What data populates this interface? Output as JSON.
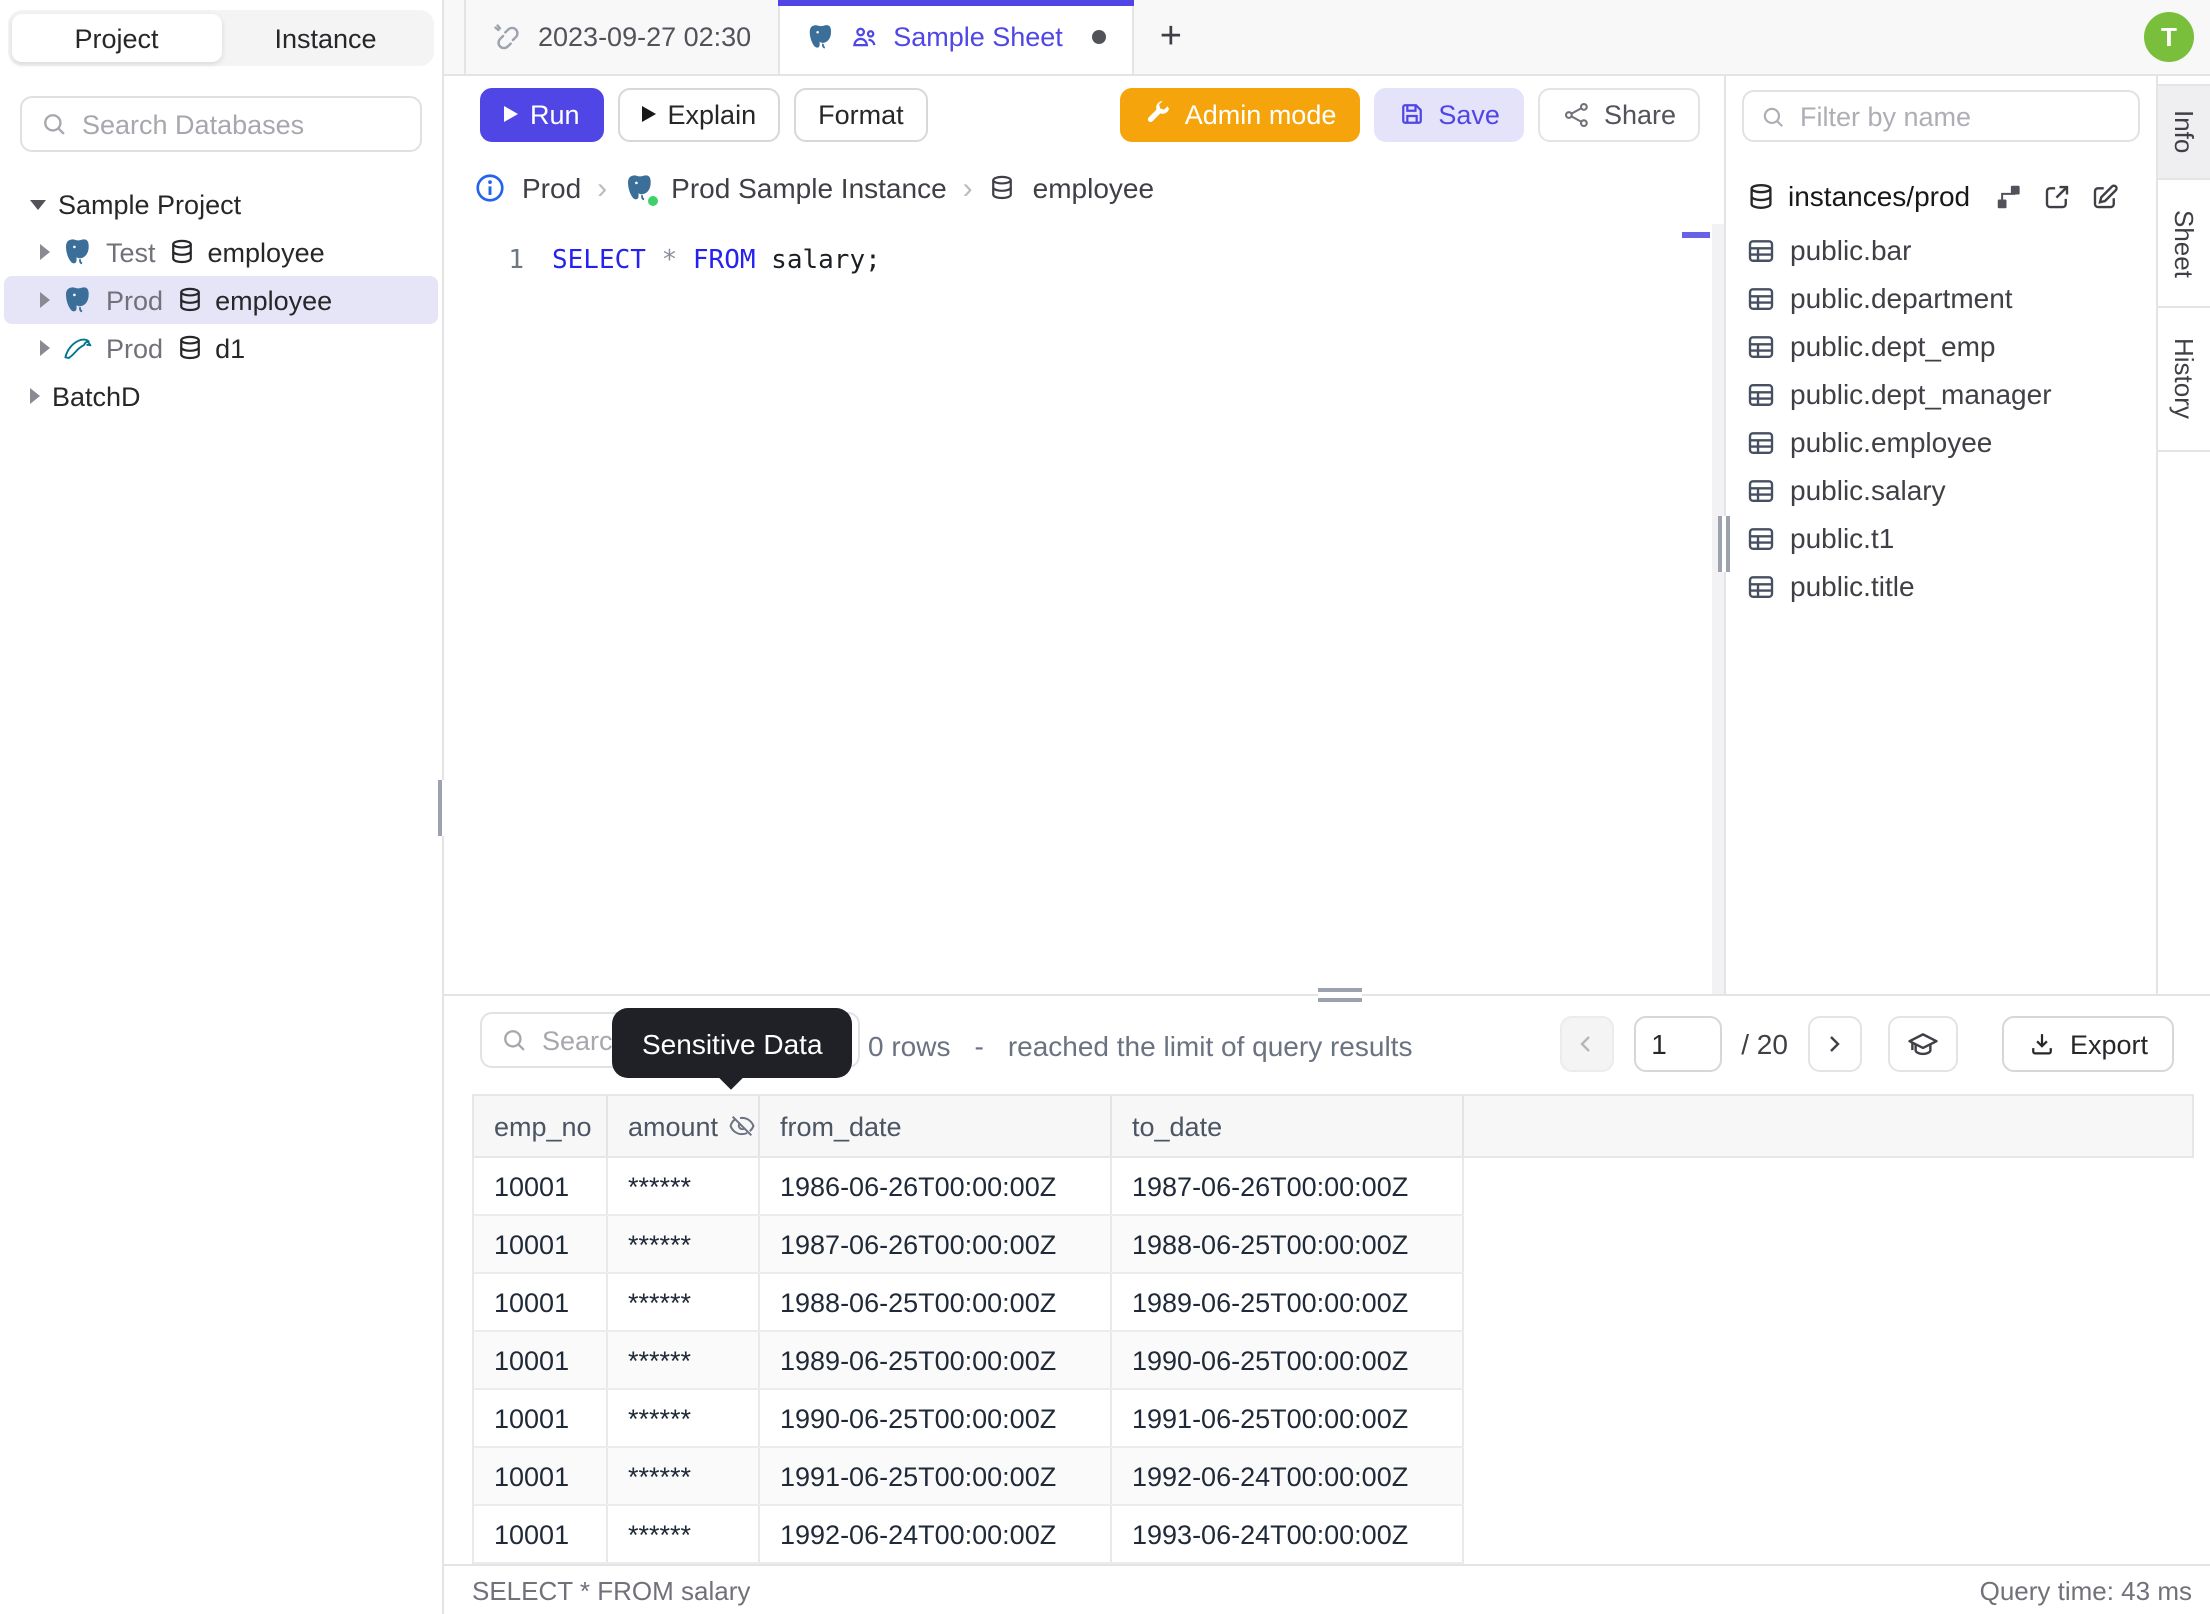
{
  "app": {
    "accent_color": "#4f46e5",
    "admin_color": "#f5a40b",
    "keyword_color": "#2521f0",
    "tooltip_bg": "#202127",
    "selected_tree_bg": "#e6e5f7",
    "avatar_color": "#7abf3c"
  },
  "sidebar": {
    "tabs": [
      {
        "label": "Project"
      },
      {
        "label": "Instance"
      }
    ],
    "search_placeholder": "Search Databases",
    "tree": {
      "project": "Sample Project",
      "items": [
        {
          "env": "Test",
          "db": "employee",
          "engine": "postgresql"
        },
        {
          "env": "Prod",
          "db": "employee",
          "engine": "postgresql"
        },
        {
          "env": "Prod",
          "db": "d1",
          "engine": "mysql"
        }
      ],
      "batch": "BatchD"
    }
  },
  "tabstrip": {
    "sheet_tab_1": "2023-09-27 02:30",
    "sheet_tab_2": "Sample Sheet",
    "new_tab": "+",
    "avatar": "T"
  },
  "toolbar": {
    "run": "Run",
    "explain": "Explain",
    "format": "Format",
    "admin_mode": "Admin mode",
    "save": "Save",
    "share": "Share"
  },
  "breadcrumb": {
    "environment": "Prod",
    "instance": "Prod Sample Instance",
    "database": "employee"
  },
  "editor": {
    "line_number": "1",
    "keyword_1": "SELECT",
    "operator": "*",
    "keyword_2": "FROM",
    "identifier": " salary;"
  },
  "schema_panel": {
    "filter_placeholder": "Filter by name",
    "database_path": "instances/prod",
    "tables": [
      "public.bar",
      "public.department",
      "public.dept_emp",
      "public.dept_manager",
      "public.employee",
      "public.salary",
      "public.t1",
      "public.title"
    ]
  },
  "side_tabs": [
    "Info",
    "Sheet",
    "History"
  ],
  "results": {
    "search_placeholder": "Search",
    "tooltip": "Sensitive Data",
    "row_count": "0 rows",
    "separator": "-",
    "limit_note": "reached the limit of query results",
    "page_value": "1",
    "page_total": "/ 20",
    "export_label": "Export",
    "columns": [
      "emp_no",
      "amount",
      "from_date",
      "to_date"
    ],
    "masked_column": "amount",
    "rows": [
      [
        "10001",
        "******",
        "1986-06-26T00:00:00Z",
        "1987-06-26T00:00:00Z"
      ],
      [
        "10001",
        "******",
        "1987-06-26T00:00:00Z",
        "1988-06-25T00:00:00Z"
      ],
      [
        "10001",
        "******",
        "1988-06-25T00:00:00Z",
        "1989-06-25T00:00:00Z"
      ],
      [
        "10001",
        "******",
        "1989-06-25T00:00:00Z",
        "1990-06-25T00:00:00Z"
      ],
      [
        "10001",
        "******",
        "1990-06-25T00:00:00Z",
        "1991-06-25T00:00:00Z"
      ],
      [
        "10001",
        "******",
        "1991-06-25T00:00:00Z",
        "1992-06-24T00:00:00Z"
      ],
      [
        "10001",
        "******",
        "1992-06-24T00:00:00Z",
        "1993-06-24T00:00:00Z"
      ]
    ]
  },
  "status_bar": {
    "statement": "SELECT * FROM salary",
    "query_time": "Query time: 43 ms"
  }
}
